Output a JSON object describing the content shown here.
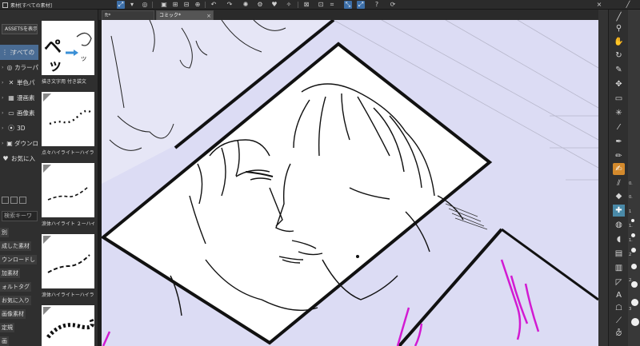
{
  "panel": {
    "title": "素材[すべての素材]",
    "assets_button": "ASSETSを表示",
    "search_placeholder": "検索キーワ"
  },
  "tree": [
    {
      "label": "すべての",
      "selected": true,
      "icon": "grid-icon",
      "glyph": "⋮⋮"
    },
    {
      "label": "カラーパ",
      "selected": false,
      "icon": "palette-icon",
      "glyph": "◎"
    },
    {
      "label": "単色パ",
      "selected": false,
      "icon": "x-pattern-icon",
      "glyph": "✕"
    },
    {
      "label": "漫画素",
      "selected": false,
      "icon": "manga-icon",
      "glyph": "▦"
    },
    {
      "label": "画像素",
      "selected": false,
      "icon": "image-icon",
      "glyph": "▭"
    },
    {
      "label": "3D",
      "selected": false,
      "icon": "3d-icon",
      "glyph": "⦿"
    },
    {
      "label": "ダウンロ",
      "selected": false,
      "icon": "download-icon",
      "glyph": "▣"
    },
    {
      "label": "お気に入",
      "selected": false,
      "icon": "heart-icon",
      "glyph": "♥"
    }
  ],
  "tags": [
    "別",
    "成した素材",
    "ウンロードし",
    "加素材",
    "ォルトタグ",
    "お気に入り",
    "画像素材",
    "定規",
    "画"
  ],
  "thumbnails": [
    {
      "label": "描き文字用 付き袋文"
    },
    {
      "label": "点々ハイライトーハイラ"
    },
    {
      "label": "涙体ハイライト ２ーハイ"
    },
    {
      "label": "涙体ハイライトーハイラ"
    },
    {
      "label": ""
    }
  ],
  "tabs": [
    {
      "label": "ft*",
      "active": false
    },
    {
      "label": "コミック*",
      "active": true
    }
  ],
  "topbar_icons": [
    "expand-icon",
    "undo-icon",
    "redo-icon",
    "deselect-icon",
    "wand-icon",
    "gear-icon",
    "heart-icon",
    "crop-icon",
    "help-icon",
    "refresh-icon"
  ],
  "right_tools": [
    {
      "name": "zoom-icon",
      "glyph": "🔍"
    },
    {
      "name": "hand-icon",
      "glyph": "✋"
    },
    {
      "name": "rotate-icon",
      "glyph": "↻"
    },
    {
      "name": "pen-tool-icon",
      "glyph": "✎"
    },
    {
      "name": "move-icon",
      "glyph": "✥"
    },
    {
      "name": "select-rect-icon",
      "glyph": "▭"
    },
    {
      "name": "magic-wand-icon",
      "glyph": "✳"
    },
    {
      "name": "eyedropper-icon",
      "glyph": "⁄"
    },
    {
      "name": "pen-icon",
      "glyph": "✒"
    },
    {
      "name": "pencil-icon",
      "glyph": "✏"
    },
    {
      "name": "brush-active-icon",
      "glyph": "✍"
    },
    {
      "name": "airbrush-icon",
      "glyph": "⫽"
    },
    {
      "name": "eraser-icon",
      "glyph": "◆"
    },
    {
      "name": "blend-icon",
      "glyph": "✚"
    },
    {
      "name": "fill-icon",
      "glyph": "💧"
    },
    {
      "name": "fill-alt-icon",
      "glyph": "◖"
    },
    {
      "name": "gradient-icon",
      "glyph": "▤"
    },
    {
      "name": "frame-icon",
      "glyph": "▥"
    },
    {
      "name": "shape-icon",
      "glyph": "◸"
    },
    {
      "name": "text-icon",
      "glyph": "A"
    },
    {
      "name": "balloon-icon",
      "glyph": "☖"
    },
    {
      "name": "ruler-icon",
      "glyph": "⟋"
    },
    {
      "name": "correct-icon",
      "glyph": "⦲"
    }
  ],
  "brush_sizes": [
    "0.",
    "0.",
    "1",
    "1.",
    "1.",
    "2",
    "2.",
    "3"
  ],
  "colors": {
    "canvas_bg": "#dcdcf4",
    "accent_tool": "#d48a2c",
    "selected_row": "#4a6c94"
  }
}
